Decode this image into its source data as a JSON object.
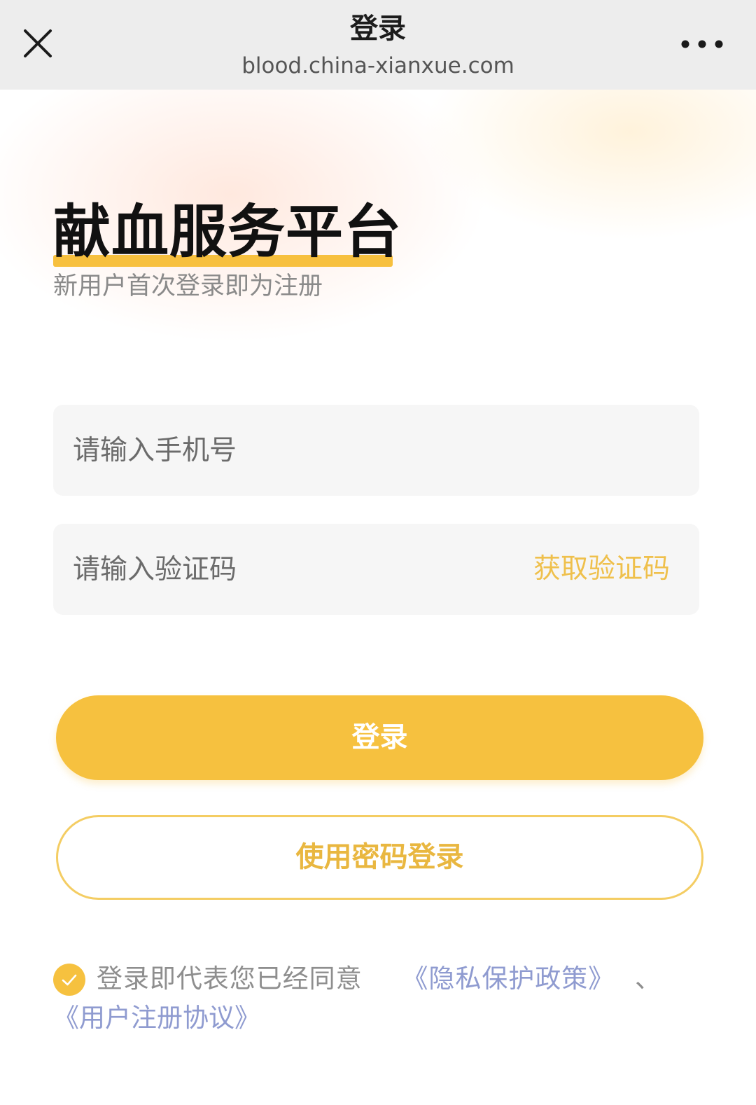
{
  "navbar": {
    "title": "登录",
    "url": "blood.china-xianxue.com",
    "close_icon": "close-icon",
    "more_icon": "more-horizontal-icon"
  },
  "header": {
    "title": "献血服务平台",
    "subtitle": "新用户首次登录即为注册"
  },
  "form": {
    "phone": {
      "value": "",
      "placeholder": "请输入手机号"
    },
    "code": {
      "value": "",
      "placeholder": "请输入验证码",
      "get_code_label": "获取验证码"
    }
  },
  "buttons": {
    "login_label": "登录",
    "password_login_label": "使用密码登录"
  },
  "agreement": {
    "checked": true,
    "check_icon": "checkmark-icon",
    "prefix": "登录即代表您已经同意",
    "privacy_link": "《隐私保护政策》",
    "separator": "、",
    "terms_link": "《用户注册协议》"
  },
  "colors": {
    "accent": "#f6c13f",
    "accent_text": "#e9b740",
    "link": "#8f9bd0",
    "navbar_bg": "#ededed",
    "field_bg": "#f6f6f6"
  }
}
